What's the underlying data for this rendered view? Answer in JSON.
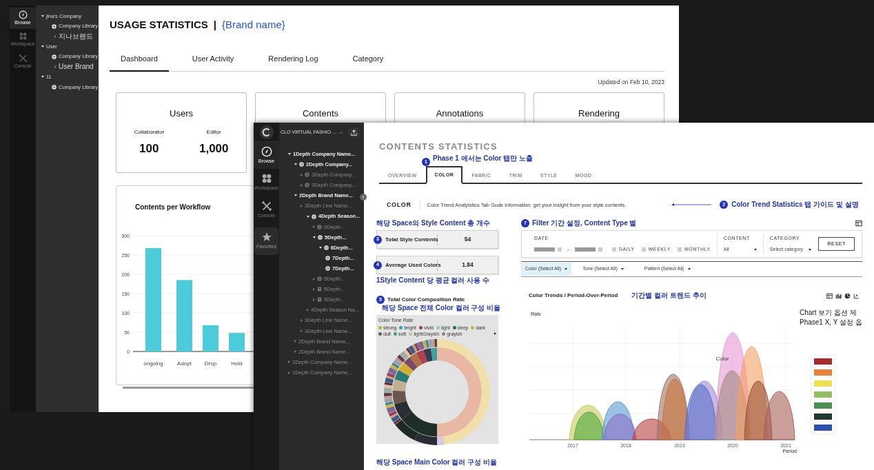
{
  "background_window": {
    "rail": [
      {
        "label": "Browse",
        "kind": "browse",
        "selected": true
      },
      {
        "label": "Workspace",
        "kind": "workspace",
        "selected": false
      },
      {
        "label": "Console",
        "kind": "console",
        "selected": false
      }
    ],
    "tree": [
      {
        "label": "jina's Company",
        "kind": "group",
        "expanded": true,
        "children": [
          {
            "label": "Company Library",
            "kind": "library"
          },
          {
            "label": "지나브랜드",
            "kind": "brand",
            "expanded": false
          }
        ]
      },
      {
        "label": "User",
        "kind": "group",
        "expanded": true,
        "children": [
          {
            "label": "Company Library",
            "kind": "library"
          },
          {
            "label": "User Brand",
            "kind": "brand",
            "expanded": false
          }
        ]
      },
      {
        "label": "11",
        "kind": "group",
        "expanded": true,
        "children": [
          {
            "label": "Company Library",
            "kind": "library"
          }
        ]
      }
    ],
    "title": "USAGE STATISTICS",
    "separator": "|",
    "brand": "{Brand name}",
    "tabs": [
      {
        "label": "Dashboard",
        "selected": true
      },
      {
        "label": "User Activity",
        "selected": false
      },
      {
        "label": "Rendering Log",
        "selected": false
      },
      {
        "label": "Category",
        "selected": false
      }
    ],
    "updated": "Updated on Feb 10, 2023",
    "cards": [
      {
        "title": "Users",
        "stats": [
          {
            "label": "Collaborator",
            "value": "100"
          },
          {
            "label": "Editor",
            "value": "1,000"
          }
        ]
      },
      {
        "title": "Contents"
      },
      {
        "title": "Annotations"
      },
      {
        "title": "Rendering"
      }
    ],
    "workflow_card": {
      "chart_data": {
        "type": "bar",
        "title": "Contents per Workflow",
        "categories": [
          "ongoing",
          "Adopt",
          "Drop",
          "Hold"
        ],
        "values": [
          268,
          185,
          68,
          48
        ],
        "ylim": [
          0,
          300
        ],
        "grid": true,
        "yticks": [
          0,
          50,
          100,
          150,
          200,
          250,
          300
        ]
      }
    }
  },
  "front_window": {
    "app_name": "CLO VIRTUAL FASHIO ...",
    "rail": [
      {
        "label": "Browse",
        "kind": "browse",
        "selected": true
      },
      {
        "label": "Workspace",
        "kind": "workspace",
        "selected": false
      },
      {
        "label": "Console",
        "kind": "console",
        "selected": false
      },
      {
        "label": "Favorites",
        "kind": "favorites",
        "selected": false
      }
    ],
    "tree": [
      {
        "label": "1Depth Company Name...",
        "kind": "plain",
        "expanded": true,
        "emphasized": true,
        "children": [
          {
            "label": "2Depth Company...",
            "kind": "badge",
            "expanded": true,
            "emphasized": true,
            "children": [
              {
                "label": "3Depth Company...",
                "kind": "badge",
                "expanded": false,
                "emphasized": false
              },
              {
                "label": "3Depth Company...",
                "kind": "badge",
                "expanded": false,
                "emphasized": false
              }
            ]
          },
          {
            "label": "2Depth Brand Name...",
            "kind": "plain",
            "expanded": true,
            "emphasized": true,
            "children": [
              {
                "label": "3Depth Line Name...",
                "kind": "plain",
                "expanded": false,
                "emphasized": false,
                "children": [
                  {
                    "label": "4Depth Season...",
                    "kind": "badge",
                    "expanded": true,
                    "emphasized": true,
                    "children": [
                      {
                        "label": "5Depth...",
                        "kind": "badge",
                        "expanded": false,
                        "emphasized": false
                      },
                      {
                        "label": "5Depth...",
                        "kind": "badge",
                        "expanded": true,
                        "emphasized": true,
                        "children": [
                          {
                            "label": "6Depth...",
                            "kind": "badge",
                            "expanded": true,
                            "emphasized": true,
                            "children": [
                              {
                                "label": "7Depth...",
                                "kind": "badge",
                                "emphasized": true
                              },
                              {
                                "label": "7Depth...",
                                "kind": "badge",
                                "emphasized": true
                              }
                            ]
                          }
                        ]
                      },
                      {
                        "label": "5Depth...",
                        "kind": "badge",
                        "expanded": false,
                        "emphasized": false
                      },
                      {
                        "label": "5Depth...",
                        "kind": "page",
                        "expanded": false,
                        "emphasized": false
                      },
                      {
                        "label": "5Depth...",
                        "kind": "page",
                        "expanded": false,
                        "emphasized": false
                      }
                    ]
                  },
                  {
                    "label": "4Depth Season Na...",
                    "kind": "plain",
                    "expanded": false,
                    "emphasized": false
                  }
                ]
              },
              {
                "label": "3Depth Line Name...",
                "kind": "plain",
                "expanded": false,
                "emphasized": false
              },
              {
                "label": "3Depth Line Name...",
                "kind": "plain",
                "expanded": false,
                "emphasized": false
              }
            ]
          },
          {
            "label": "2Depth Brand Name...",
            "kind": "plain",
            "expanded": false,
            "emphasized": false
          },
          {
            "label": "2Depth Brand Name...",
            "kind": "plain",
            "expanded": false,
            "emphasized": false
          }
        ]
      },
      {
        "label": "1Depth Company Name...",
        "kind": "plain",
        "expanded": false,
        "emphasized": false
      },
      {
        "label": "1Depth Company Name...",
        "kind": "plain",
        "expanded": false,
        "emphasized": false
      }
    ],
    "title": "CONTENTS STATISTICS",
    "tab_note": {
      "marker": "1",
      "text": "Phase 1 에서는 Color 탭만 노출"
    },
    "tabs": [
      {
        "label": "OVERVIEW",
        "selected": false
      },
      {
        "label": "COLOR",
        "selected": true
      },
      {
        "label": "FABRIC",
        "selected": false
      },
      {
        "label": "TRIM",
        "selected": false
      },
      {
        "label": "STYLE",
        "selected": false
      },
      {
        "label": "MOOD",
        "selected": false
      }
    ],
    "section": {
      "title": "COLOR",
      "description": "Color Trend Analyistics Tab Gude information. get your insight from your style contents.",
      "note": {
        "marker": "2",
        "text": "Color Trend Statistics 탭 가이드 및 설명"
      }
    },
    "kpi_note": "해당 Space의 Style Content 총 개수",
    "kpis": [
      {
        "marker": "3",
        "label": "Total Style Contents",
        "value": "54"
      },
      {
        "marker": "4",
        "label": "Average Used Colors",
        "value": "1.84"
      }
    ],
    "kpi_footnote": "1Style Content 당 평균 컬러 사용 수",
    "composition": {
      "marker": "5",
      "title": "Total Color Composition Rate",
      "subtitle": "해당 Space  전체 Color 컬러 구성 비율",
      "legend_title": "Color Tone Rate",
      "legend": [
        {
          "label": "strong",
          "color": "#b8b830"
        },
        {
          "label": "bright",
          "color": "#2fa0c0"
        },
        {
          "label": "vivid",
          "color": "#a03080"
        },
        {
          "label": "light",
          "color": "#80d0c0"
        },
        {
          "label": "deep",
          "color": "#207070"
        },
        {
          "label": "dark",
          "color": "#d0b040"
        },
        {
          "label": "dull",
          "color": "#606060"
        },
        {
          "label": "soft",
          "color": "#40a080"
        },
        {
          "label": "lightGrayish",
          "color": "#c0c0a0"
        },
        {
          "label": "grayish",
          "color": "#a08070"
        }
      ]
    },
    "bottom_note": "해당 Space  Main Color 컬러 구성 비율",
    "filter": {
      "marker": "7",
      "note": "Filter 기간 설정, Content Type 별",
      "date_label": "DATE",
      "date_separator": "-",
      "periods": [
        {
          "label": "DAILY",
          "checked": false
        },
        {
          "label": "WEEKLY",
          "checked": false
        },
        {
          "label": "MONTHLY",
          "checked": false
        }
      ],
      "content": {
        "label": "CONTENT",
        "value": "All"
      },
      "category": {
        "label": "CATEGORY",
        "value": "Select category"
      },
      "reset": "RESET",
      "dropdowns": [
        {
          "label": "Color (Select All)",
          "selected": true
        },
        {
          "label": "Tone (Select All)",
          "selected": false
        },
        {
          "label": "Pattern (Select All)",
          "selected": false
        }
      ]
    },
    "trends": {
      "title": "Color Trends / Period-Over-Period",
      "note": "기간별 컬러 트렌드 추이",
      "ylabel": "Rate",
      "xlabel": "Period",
      "series_label": "Color",
      "x_labels": [
        "2017",
        "2018",
        "2019",
        "2020",
        "2021"
      ],
      "side_notes": [
        "Chart 보기 옵션  제",
        "Phase1  X, Y 설정 옵"
      ],
      "legend": [
        {
          "color": "#a82a2a"
        },
        {
          "color": "#e8833a"
        },
        {
          "color": "#f0e050"
        },
        {
          "color": "#90c060"
        },
        {
          "color": "#4a9050"
        },
        {
          "color": "#203a30"
        },
        {
          "color": "#2a50b0"
        }
      ]
    }
  }
}
